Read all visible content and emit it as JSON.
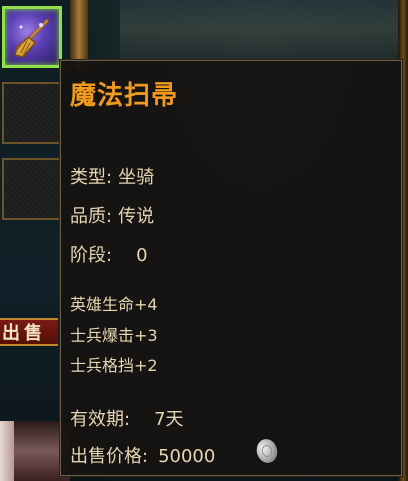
{
  "item": {
    "name": "魔法扫帚",
    "type_label": "类型:",
    "type_value": "坐骑",
    "quality_label": "品质:",
    "quality_value": "传说",
    "stage_label": "阶段:",
    "stage_value": "0",
    "stats": [
      "英雄生命+4",
      "士兵爆击+3",
      "士兵格挡+2"
    ],
    "validity_label": "有效期:",
    "validity_value": "7天",
    "price_label": "出售价格:",
    "price_value": "50000"
  },
  "sidebar": {
    "sell_tab_label": "出售"
  },
  "icons": {
    "item": "broom-icon",
    "currency": "silver-coin-icon"
  },
  "colors": {
    "item_name": "#f29a1e",
    "text": "#e6d5b2",
    "active_slot_border": "#8fe04a"
  }
}
